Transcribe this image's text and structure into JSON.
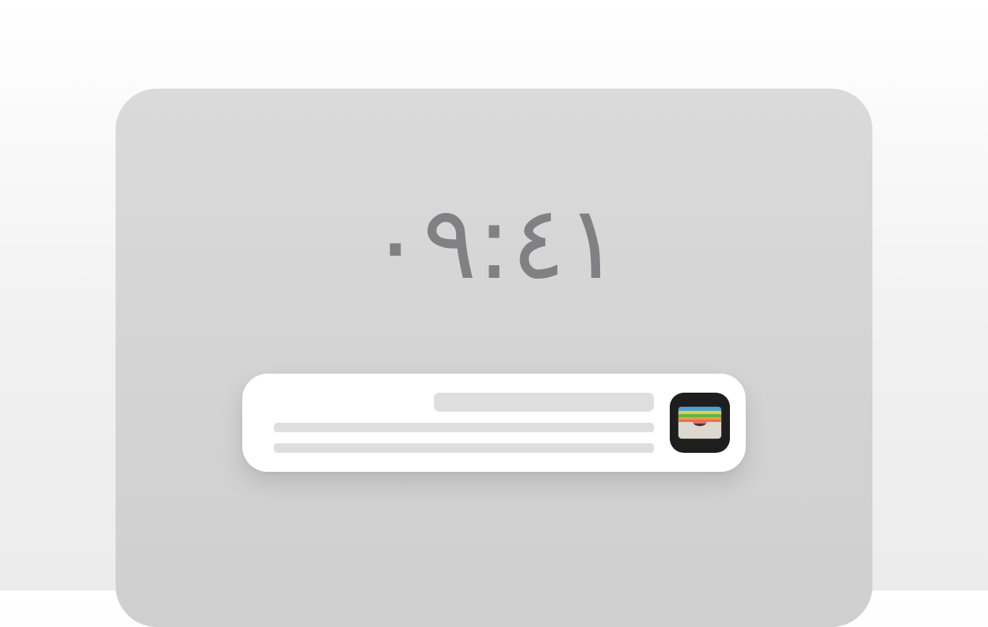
{
  "lock_screen": {
    "time": "٠٩:٤١"
  },
  "notification": {
    "app_icon": "wallet-icon",
    "app_icon_colors": {
      "background": "#1e1e1e",
      "card_blue": "#3fa7dd",
      "card_yellow": "#f5c542",
      "card_green": "#58b947",
      "card_orange": "#f29b38",
      "card_red": "#ef6b5b",
      "pocket": "#dcd8cf"
    },
    "placeholder_color": "#dedede"
  }
}
